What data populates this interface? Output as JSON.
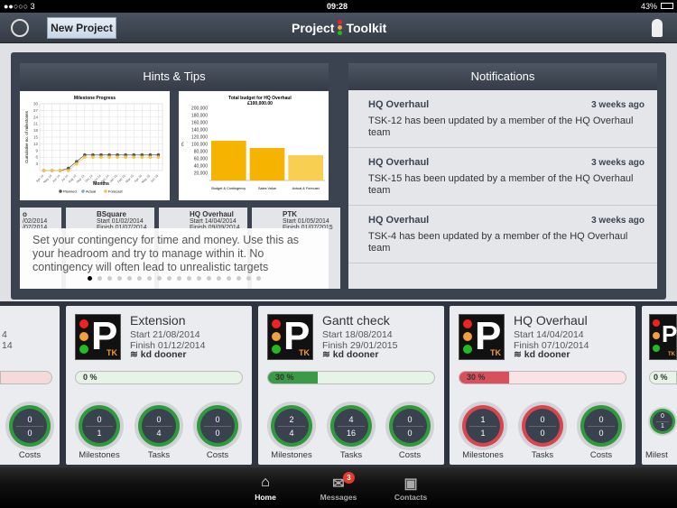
{
  "status": {
    "carrier": "●●○○○ 3",
    "time": "09:28",
    "battery": "43%"
  },
  "nav": {
    "new_project": "New Project",
    "title_left": "Project",
    "title_right": "Toolkit"
  },
  "hints": {
    "title": "Hints & Tips",
    "tip": "Set your contingency for time and money. Use this as your headroom and try to manage within it. No contingency will often lead to unrealistic targets",
    "page_count": 18,
    "active_page": 0,
    "behind": [
      {
        "name": "o",
        "start": "/02/2014",
        "finish": "/07/2014"
      },
      {
        "name": "BSquare",
        "start": "Start 01/02/2014",
        "finish": "Finish 01/07/2014"
      },
      {
        "name": "HQ Overhaul",
        "start": "Start 14/04/2014",
        "finish": "Finish 09/09/2014"
      },
      {
        "name": "PTK",
        "start": "Start 01/05/2014",
        "finish": "Finish 01/07/2015"
      }
    ]
  },
  "chart_data": [
    {
      "type": "line",
      "title": "Milestone Progress",
      "xlabel": "Months",
      "ylabel": "Cumulative no. of milestones",
      "ylim": [
        0,
        30
      ],
      "yticks": [
        3,
        6,
        9,
        12,
        15,
        18,
        21,
        24,
        27,
        30
      ],
      "categories": [
        "Apr 14",
        "May 14",
        "Jun 14",
        "Jul 14",
        "Aug 14",
        "Sep 14",
        "Oct 14",
        "Nov 14",
        "Dec 14",
        "Jan 15",
        "Feb 15",
        "Mar 15",
        "Apr 15",
        "May 15",
        "Jun 15"
      ],
      "series": [
        {
          "name": "Planned",
          "color": "#555555",
          "values": [
            0,
            0,
            0,
            1,
            4,
            7,
            7,
            7,
            7,
            7,
            7,
            7,
            7,
            7,
            7
          ]
        },
        {
          "name": "Actual",
          "color": "#6fa8dc",
          "values": [
            0,
            0,
            0,
            null,
            null,
            null,
            null,
            null,
            null,
            null,
            null,
            null,
            null,
            null,
            null
          ]
        },
        {
          "name": "Forecast",
          "color": "#f2c24a",
          "values": [
            0,
            0,
            0,
            0,
            3,
            6,
            6,
            6,
            6,
            6,
            6,
            6,
            6,
            6,
            6
          ]
        }
      ]
    },
    {
      "type": "bar",
      "title": "Total budget for HQ Overhaul",
      "subtitle": "£100,000.00",
      "ylabel": "£",
      "ylim": [
        0,
        200000
      ],
      "yticks": [
        "20,000",
        "40,000",
        "60,000",
        "80,000",
        "100,000",
        "120,000",
        "140,000",
        "160,000",
        "180,000",
        "200,000"
      ],
      "categories": [
        "Budget & Contingency",
        "Sales Value",
        "Actual & Forecast"
      ],
      "values": [
        110000,
        90000,
        70000
      ]
    }
  ],
  "notifications": {
    "title": "Notifications",
    "items": [
      {
        "project": "HQ Overhaul",
        "time": "3 weeks ago",
        "text": "TSK-12 has been updated by a member of the HQ Overhaul team"
      },
      {
        "project": "HQ Overhaul",
        "time": "3 weeks ago",
        "text": "TSK-15 has been updated by a member of the HQ Overhaul team"
      },
      {
        "project": "HQ Overhaul",
        "time": "3 weeks ago",
        "text": "TSK-4 has been updated by a member of the HQ Overhaul team"
      }
    ]
  },
  "projects": [
    {
      "name": "",
      "start": "4",
      "finish": "14",
      "owner": "",
      "progress_label": "",
      "progress": 0,
      "color": "#f5dada",
      "gauges": [
        {
          "label": "Costs",
          "top": "0",
          "bottom": "0",
          "status": "green"
        }
      ]
    },
    {
      "name": "Extension",
      "start": "Start 21/08/2014",
      "finish": "Finish 01/12/2014",
      "owner": "kd dooner",
      "progress_label": "0 %",
      "progress": 0,
      "color": "#e6f3e6",
      "gauges": [
        {
          "label": "Milestones",
          "top": "0",
          "bottom": "1",
          "status": "green"
        },
        {
          "label": "Tasks",
          "top": "0",
          "bottom": "4",
          "status": "green"
        },
        {
          "label": "Costs",
          "top": "0",
          "bottom": "0",
          "status": "green"
        }
      ]
    },
    {
      "name": "Gantt check",
      "start": "Start 18/08/2014",
      "finish": "Finish 29/01/2015",
      "owner": "kd dooner",
      "progress_label": "30 %",
      "progress": 30,
      "color": "#e6f3e6",
      "gauges": [
        {
          "label": "Milestones",
          "top": "2",
          "bottom": "4",
          "status": "green"
        },
        {
          "label": "Tasks",
          "top": "4",
          "bottom": "16",
          "status": "green"
        },
        {
          "label": "Costs",
          "top": "0",
          "bottom": "0",
          "status": "green"
        }
      ]
    },
    {
      "name": "HQ Overhaul",
      "start": "Start 14/04/2014",
      "finish": "Finish 07/10/2014",
      "owner": "kd dooner",
      "progress_label": "30 %",
      "progress": 30,
      "color": "#fbe3e5",
      "gauges": [
        {
          "label": "Milestones",
          "top": "1",
          "bottom": "1",
          "status": "red"
        },
        {
          "label": "Tasks",
          "top": "0",
          "bottom": "0",
          "status": "red"
        },
        {
          "label": "Costs",
          "top": "0",
          "bottom": "0",
          "status": "green"
        }
      ]
    },
    {
      "name": "",
      "start": "",
      "finish": "",
      "owner": "",
      "progress_label": "0 %",
      "progress": 0,
      "color": "#e6f3e6",
      "gauges": [
        {
          "label": "Milest",
          "top": "0",
          "bottom": "1",
          "status": "green"
        }
      ]
    }
  ],
  "tabs": [
    {
      "label": "Home",
      "icon": "home"
    },
    {
      "label": "Messages",
      "icon": "mail",
      "badge": "3"
    },
    {
      "label": "Contacts",
      "icon": "contacts"
    }
  ]
}
